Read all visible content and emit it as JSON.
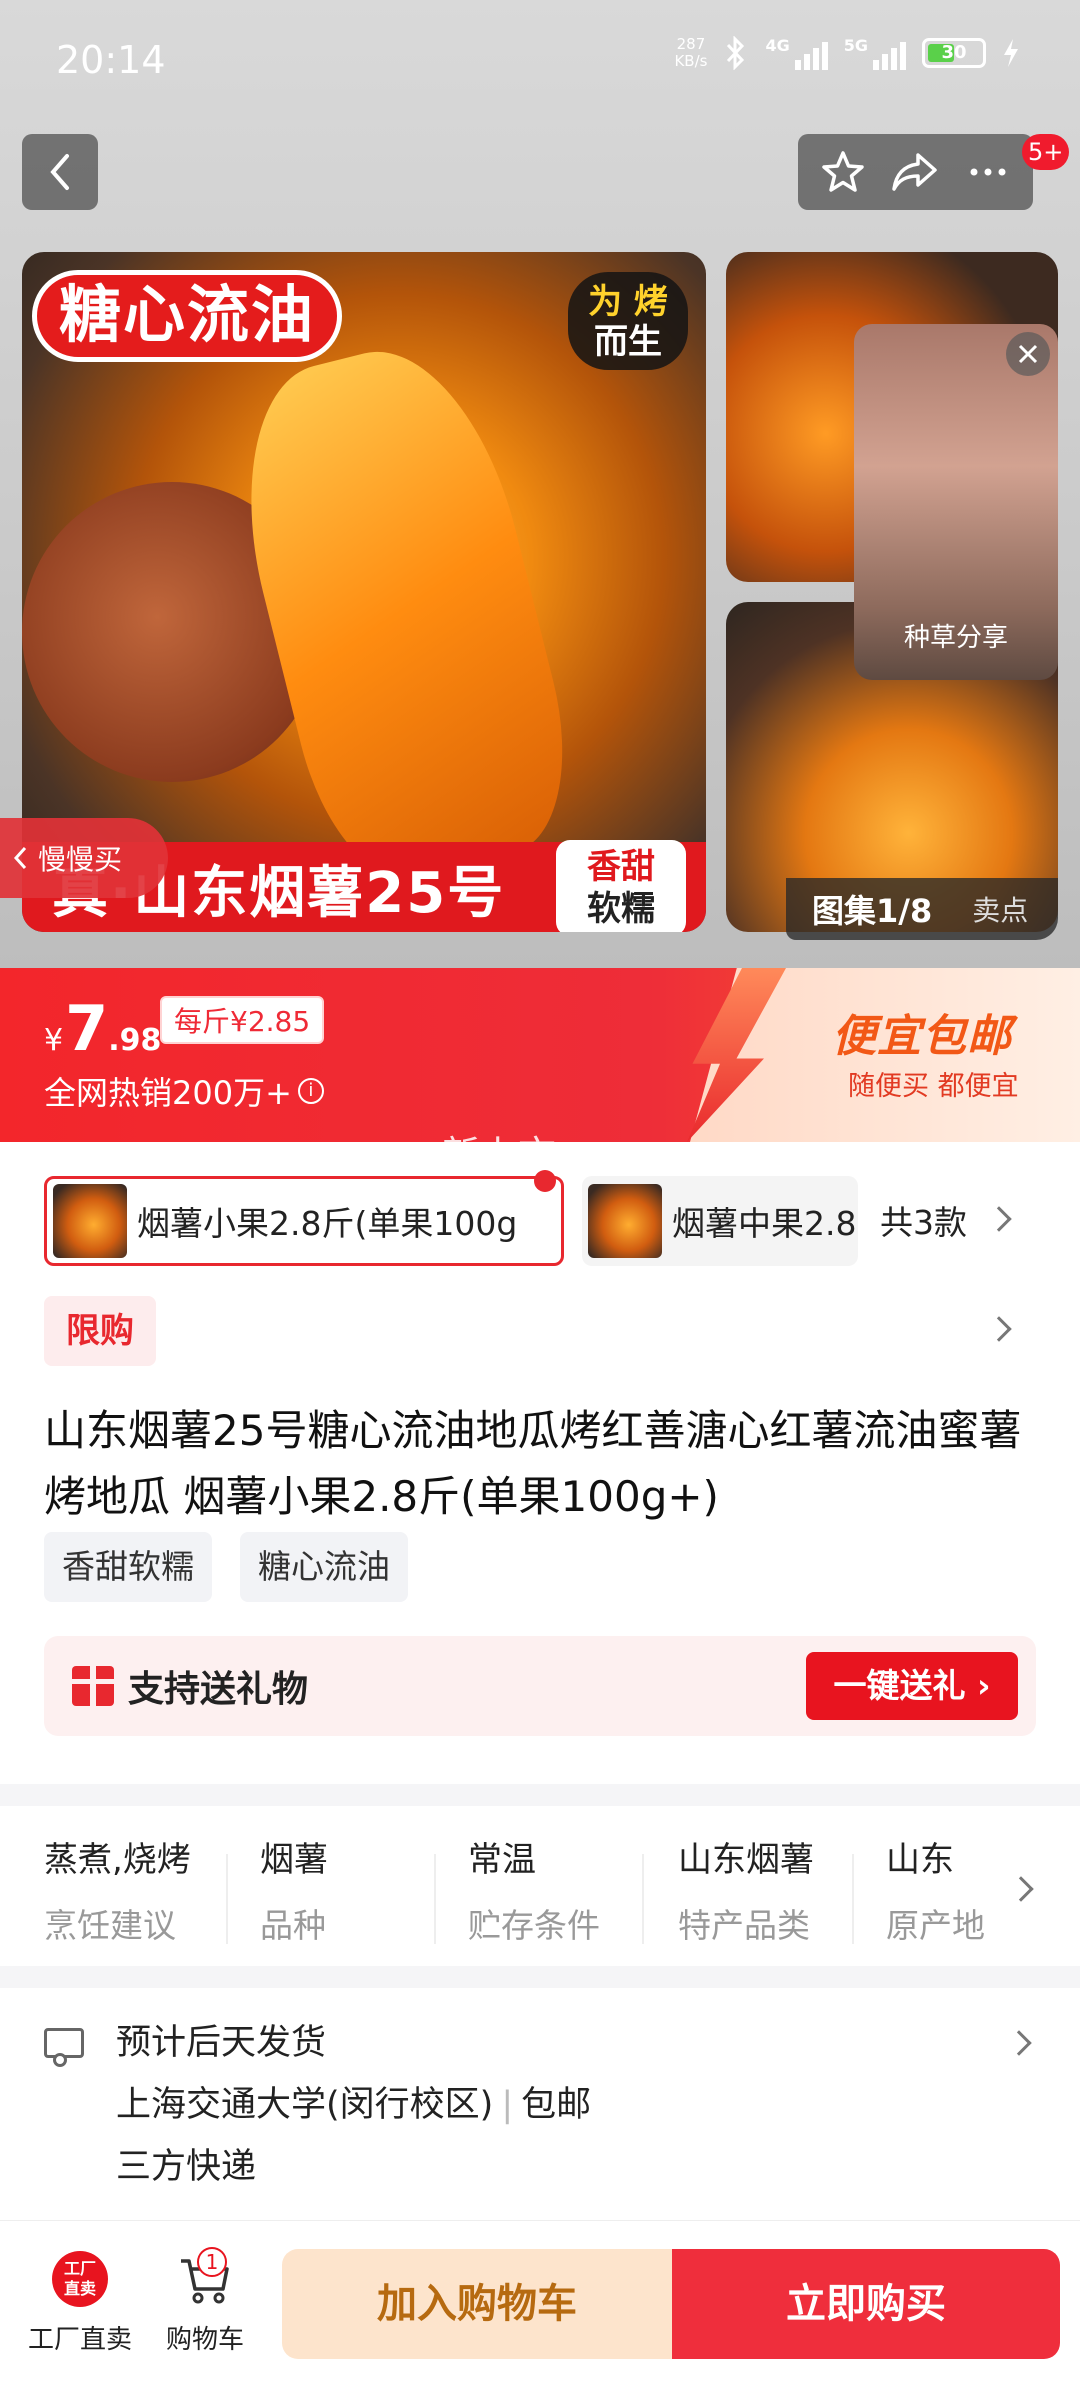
{
  "status_bar": {
    "time": "20:14",
    "net_speed_value": "287",
    "net_speed_unit": "KB/s",
    "sig1_label": "4G",
    "sig2_label": "5G",
    "battery": "30"
  },
  "header": {
    "badge": "5+"
  },
  "gallery": {
    "main_tag_red": "糖心流油",
    "main_tag_dark_line1_a": "为",
    "main_tag_dark_line1_b": "烤",
    "main_tag_dark_line2": "而生",
    "banner_text": "真·山东烟薯25号",
    "banner_tag_line1": "香甜",
    "banner_tag_line2": "软糯",
    "video_caption": "种草分享",
    "counter": "图集1/8",
    "selling_points": "卖点",
    "slow_buy": "慢慢买"
  },
  "price": {
    "currency": "¥",
    "integer": "7",
    "decimal": ".98",
    "per_jin": "每斤¥2.85",
    "hot_sale": "全网热销200万+",
    "promo_title": "便宜包邮",
    "promo_sub": "随便买 都便宜",
    "new_tag": "新上市"
  },
  "sku": {
    "selected": "烟薯小果2.8斤(单果100g",
    "other": "烟薯中果2.8",
    "count": "共3款"
  },
  "limit_tag": "限购",
  "product_title": "山东烟薯25号糖心流油地瓜烤红善溏心红薯流油蜜薯烤地瓜 烟薯小果2.8斤(单果100g+)",
  "feature_tags": [
    "香甜软糯",
    "糖心流油"
  ],
  "gift": {
    "text": "支持送礼物",
    "button": "一键送礼 ›"
  },
  "specs": [
    {
      "value": "蒸煮,烧烤",
      "key": "烹饪建议"
    },
    {
      "value": "烟薯",
      "key": "品种"
    },
    {
      "value": "常温",
      "key": "贮存条件"
    },
    {
      "value": "山东烟薯",
      "key": "特产品类"
    },
    {
      "value": "山东",
      "key": "原产地"
    }
  ],
  "shipping": {
    "eta": "预计后天发货",
    "address": "上海交通大学(闵行校区)",
    "sep": "|",
    "free": "包邮",
    "carrier": "三方快递"
  },
  "bottom": {
    "factory_icon_l1": "工厂",
    "factory_icon_l2": "直卖",
    "factory_label": "工厂直卖",
    "cart_label": "购物车",
    "cart_count": "1",
    "add_to_cart": "加入购物车",
    "buy_now": "立即购买"
  }
}
